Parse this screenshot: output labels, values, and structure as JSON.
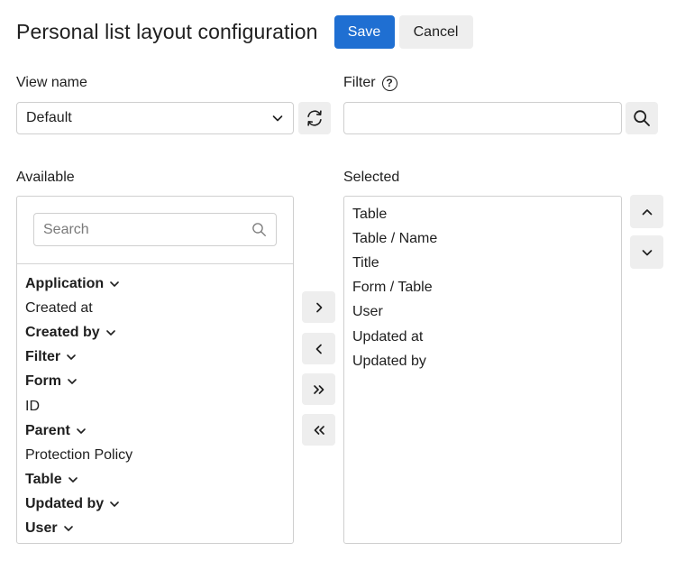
{
  "header": {
    "title": "Personal list layout configuration",
    "save_label": "Save",
    "cancel_label": "Cancel"
  },
  "view": {
    "label": "View name",
    "selected": "Default",
    "refresh_icon": "refresh-icon"
  },
  "filter": {
    "label": "Filter",
    "help_icon_glyph": "?",
    "value": "",
    "placeholder": "",
    "search_icon": "search-icon"
  },
  "available": {
    "label": "Available",
    "search_placeholder": "Search",
    "items": [
      {
        "label": "Application",
        "group": true
      },
      {
        "label": "Created at",
        "group": false
      },
      {
        "label": "Created by",
        "group": true
      },
      {
        "label": "Filter",
        "group": true
      },
      {
        "label": "Form",
        "group": true
      },
      {
        "label": "ID",
        "group": false
      },
      {
        "label": "Parent",
        "group": true
      },
      {
        "label": "Protection Policy",
        "group": false
      },
      {
        "label": "Table",
        "group": true
      },
      {
        "label": "Updated by",
        "group": true
      },
      {
        "label": "User",
        "group": true
      }
    ]
  },
  "transfer": {
    "add_glyph": "›",
    "remove_glyph": "‹",
    "add_all_glyph": "»",
    "remove_all_glyph": "«"
  },
  "selected": {
    "label": "Selected",
    "items": [
      "Table",
      "Table / Name",
      "Title",
      "Form / Table",
      "User",
      "Updated at",
      "Updated by"
    ]
  },
  "colors": {
    "primary": "#1f6fd2",
    "button_bg": "#eeeeee",
    "border": "#cfcfcf"
  }
}
